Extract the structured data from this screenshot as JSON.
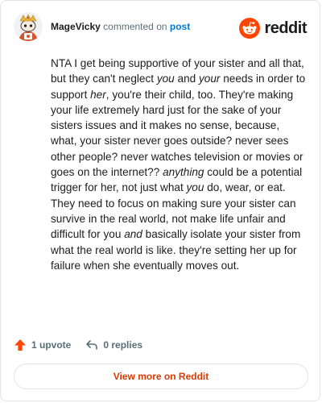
{
  "header": {
    "username": "MageVicky",
    "commented_text": " commented on ",
    "post_link": "post",
    "brand": "reddit"
  },
  "comment": {
    "segments": [
      {
        "text": "NTA I get being supportive of your sister and all that, but they can't neglect ",
        "em": false
      },
      {
        "text": "you",
        "em": true
      },
      {
        "text": " and ",
        "em": false
      },
      {
        "text": "your",
        "em": true
      },
      {
        "text": " needs in order to support ",
        "em": false
      },
      {
        "text": "her",
        "em": true
      },
      {
        "text": ", you're their child, too. They're making your life extremely hard just for the sake of your sisters issues and it makes no sense, because, what, your sister never goes outside? never sees other people? never watches television or movies or goes on the internet?? ",
        "em": false
      },
      {
        "text": "anything",
        "em": true
      },
      {
        "text": " could be a potential trigger for her, not just what ",
        "em": false
      },
      {
        "text": "you",
        "em": true
      },
      {
        "text": " do, wear, or eat. They need to focus on making sure your sister can survive in the real world, not make life unfair and difficult for you ",
        "em": false
      },
      {
        "text": "and",
        "em": true
      },
      {
        "text": " basically isolate your sister from what the real world is like. they're setting her up for failure when she eventually moves out.",
        "em": false
      }
    ]
  },
  "actions": {
    "upvote_label": "1 upvote",
    "replies_label": "0 replies"
  },
  "footer": {
    "view_more_label": "View more on Reddit"
  },
  "icons": {
    "avatar": "snoo-avatar-icon",
    "brand": "reddit-logo-icon",
    "upvote": "upvote-arrow-icon",
    "reply": "reply-arrow-icon"
  },
  "colors": {
    "brand_orange": "#ff4500",
    "link_blue": "#0079d3",
    "view_more": "#d93a00",
    "muted": "#576f76"
  }
}
